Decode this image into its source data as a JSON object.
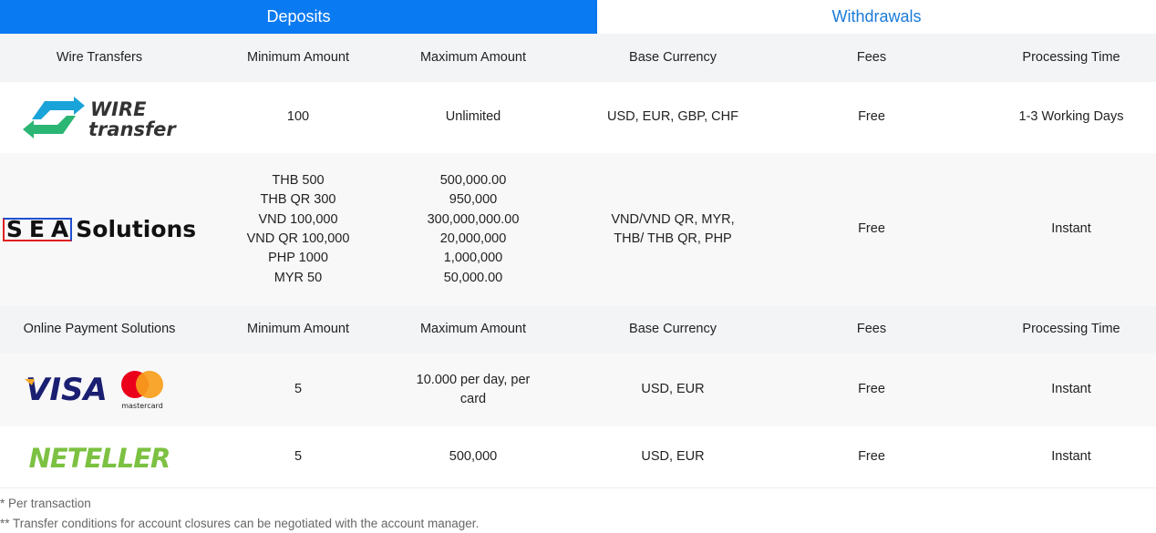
{
  "tabs": {
    "deposits": "Deposits",
    "withdrawals": "Withdrawals"
  },
  "colors": {
    "accent": "#0a7af2",
    "tab_inactive_text": "#1a7ad8",
    "header_bg": "#f3f4f6",
    "neteller_green": "#7cc142",
    "visa_blue": "#1a1f71",
    "mc_red": "#eb001b",
    "mc_orange": "#f79e1b"
  },
  "wire_section": {
    "header": {
      "title": "Wire Transfers",
      "min": "Minimum Amount",
      "max": "Maximum Amount",
      "currency": "Base Currency",
      "fees": "Fees",
      "time": "Processing Time"
    },
    "rows": [
      {
        "logo_icon": "wire-transfer-logo",
        "logo_text_1": "WIRE",
        "logo_text_2": "transfer",
        "min": "100",
        "max": "Unlimited",
        "currency": "USD, EUR, GBP, CHF",
        "fees": "Free",
        "time": "1-3 Working Days"
      },
      {
        "logo_icon": "sea-solutions-logo",
        "logo_letters": [
          "S",
          "E",
          "A"
        ],
        "logo_word": "Solutions",
        "min_lines": [
          "THB 500",
          "THB QR 300",
          "VND 100,000",
          "VND QR 100,000",
          "PHP 1000",
          "MYR 50"
        ],
        "max_lines": [
          "500,000.00",
          "950,000",
          "300,000,000.00",
          "20,000,000",
          "1,000,000",
          "50,000.00"
        ],
        "currency_lines": [
          "VND/VND QR, MYR,",
          "THB/ THB QR, PHP"
        ],
        "fees": "Free",
        "time": "Instant"
      }
    ]
  },
  "online_section": {
    "header": {
      "title": "Online Payment Solutions",
      "min": "Minimum Amount",
      "max": "Maximum Amount",
      "currency": "Base Currency",
      "fees": "Fees",
      "time": "Processing Time"
    },
    "rows": [
      {
        "logo_icon": "visa-mastercard-logo",
        "visa_text": "VISA",
        "mc_text": "mastercard",
        "min": "5",
        "max_lines": [
          "10.000 per day, per",
          "card"
        ],
        "currency": "USD, EUR",
        "fees": "Free",
        "time": "Instant"
      },
      {
        "logo_icon": "neteller-logo",
        "logo_text": "NETELLER",
        "min": "5",
        "max": "500,000",
        "currency": "USD, EUR",
        "fees": "Free",
        "time": "Instant"
      }
    ]
  },
  "footnotes": [
    "* Per transaction",
    "** Transfer conditions for account closures can be negotiated with the account manager."
  ]
}
